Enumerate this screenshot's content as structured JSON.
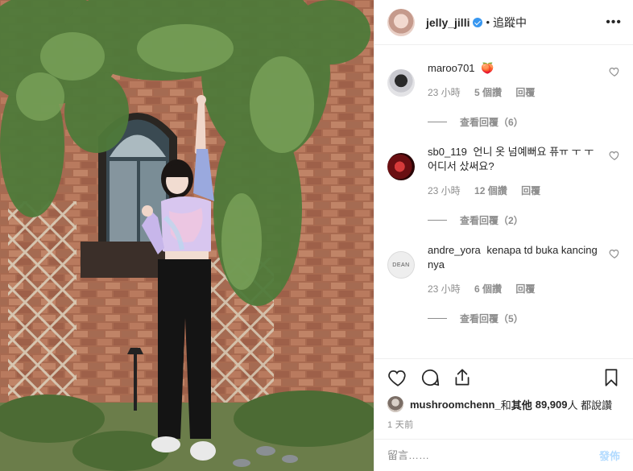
{
  "header": {
    "username": "jelly_jilli",
    "separator": "•",
    "follow_state": "追蹤中",
    "more_icon": "more-horizontal-icon"
  },
  "comments": [
    {
      "user": "maroo701",
      "text": "🍑",
      "time": "23 小時",
      "likes": "5 個讚",
      "reply": "回覆",
      "view_replies": "查看回覆（6）",
      "avatar_color": "#cfcfd4"
    },
    {
      "user": "sb0_119",
      "text": "언니 옷 넘예뻐요 퓨ㅠ ㅜ ㅜ 어디서 샀써요?",
      "time": "23 小時",
      "likes": "12 個讚",
      "reply": "回覆",
      "view_replies": "查看回覆（2）",
      "avatar_color": "#7a1a1a"
    },
    {
      "user": "andre_yora",
      "text": "kenapa td buka kancing nya",
      "time": "23 小時",
      "likes": "6 個讚",
      "reply": "回覆",
      "view_replies": "查看回覆（5）",
      "avatar_color": "#eeeeee",
      "avatar_text": "DEAN"
    }
  ],
  "actions": {
    "like_icon": "heart-icon",
    "comment_icon": "comment-icon",
    "share_icon": "share-icon",
    "save_icon": "bookmark-icon"
  },
  "likes": {
    "user": "mushroomchenn_",
    "joiner": " 和 ",
    "others_label": "其他",
    "count": "89,909",
    "suffix": " 人 都說讚"
  },
  "timestamp": "1 天前",
  "add_comment": {
    "placeholder": "留言……",
    "post_label": "發佈"
  },
  "colors": {
    "accent": "#3897f0",
    "post_disabled": "#b3dbff",
    "meta_text": "#8e8e8e"
  }
}
